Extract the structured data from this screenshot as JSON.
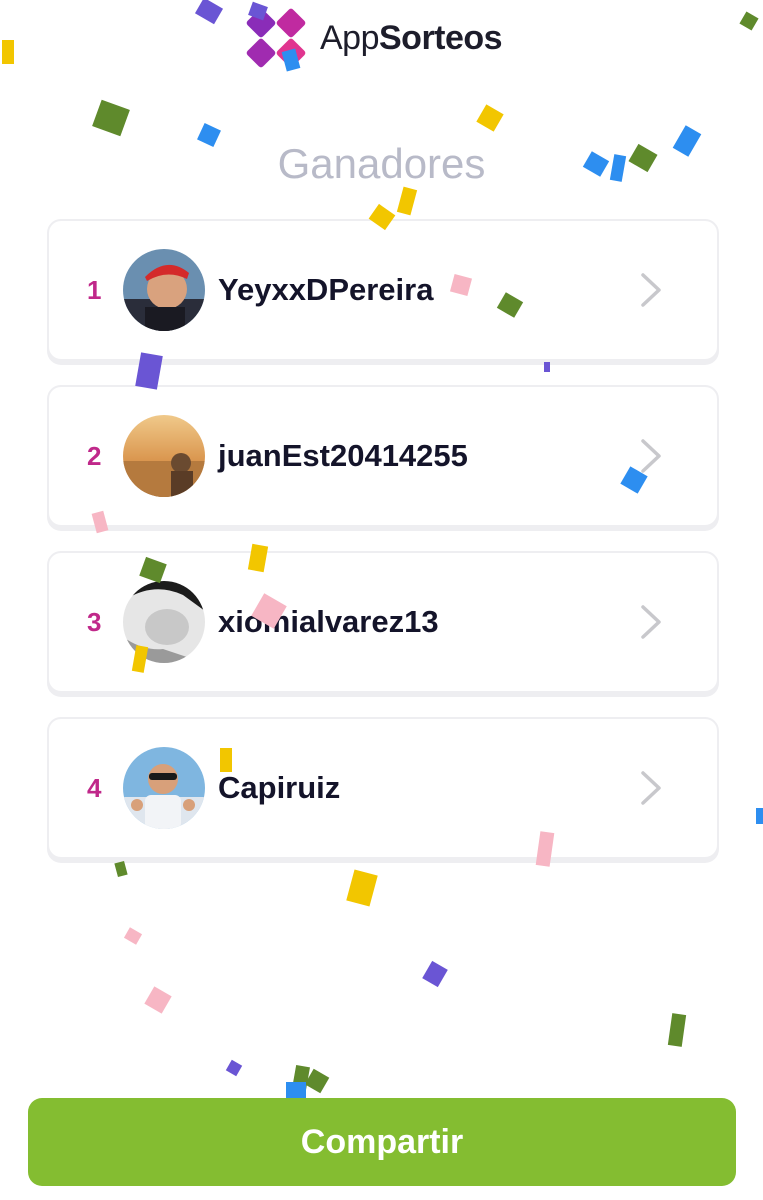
{
  "header": {
    "logo_light": "App",
    "logo_bold": "Sorteos",
    "logo_icon": "appsorteos-logo-icon"
  },
  "title": "Ganadores",
  "winners": [
    {
      "rank": "1",
      "username": "YeyxxDPereira"
    },
    {
      "rank": "2",
      "username": "juanEst20414255"
    },
    {
      "rank": "3",
      "username": "xiomialvarez13"
    },
    {
      "rank": "4",
      "username": "Capiruiz"
    }
  ],
  "share_button": {
    "label": "Compartir"
  },
  "colors": {
    "brand_magenta": "#c0288a",
    "brand_purple": "#6a3fd6",
    "title_gray": "#b8bac8",
    "button_green": "#84bd31",
    "card_border": "#eeeef1",
    "chevron_gray": "#c8c8cc"
  },
  "icons": {
    "chevron": "chevron-right-icon"
  }
}
